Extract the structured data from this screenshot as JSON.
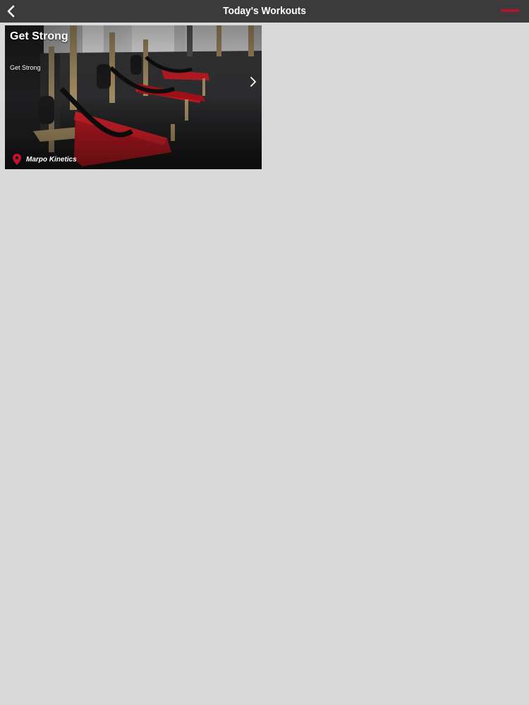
{
  "header": {
    "title": "Today's Workouts",
    "back_icon": "chevron-left-icon",
    "right_action_color": "#c8102e"
  },
  "workouts": [
    {
      "title": "Get Strong",
      "subtitle": "Get Strong",
      "location": "Marpo Kinetics",
      "location_icon": "map-pin-icon",
      "chevron_icon": "chevron-right-icon"
    }
  ],
  "colors": {
    "header_bg": "#3b3b3b",
    "page_bg": "#dad9d9",
    "accent": "#c8102e"
  }
}
